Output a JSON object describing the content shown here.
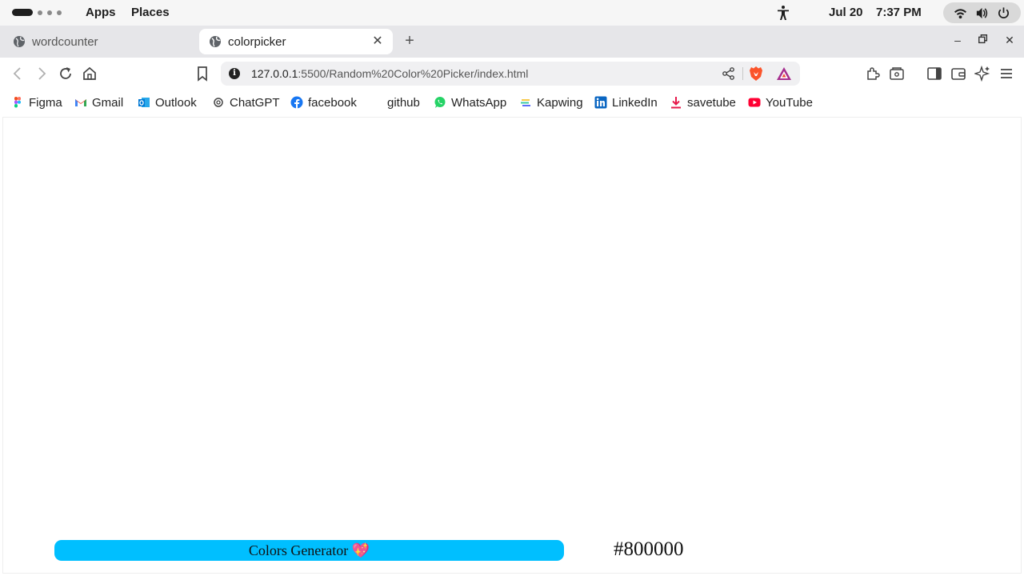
{
  "topbar": {
    "apps": "Apps",
    "places": "Places",
    "date": "Jul 20",
    "time": "7:37 PM"
  },
  "tabs": [
    {
      "title": "wordcounter",
      "active": false
    },
    {
      "title": "colorpicker",
      "active": true
    }
  ],
  "toolbar": {
    "url_host": "127.0.0.1",
    "url_path": ":5500/Random%20Color%20Picker/index.html"
  },
  "bookmarks": [
    {
      "label": "Figma",
      "icon": "figma-icon",
      "color": "#f24e1e"
    },
    {
      "label": "Gmail",
      "icon": "gmail-icon",
      "color": "#ea4335"
    },
    {
      "label": "Outlook",
      "icon": "outlook-icon",
      "color": "#0078d4"
    },
    {
      "label": "ChatGPT",
      "icon": "chatgpt-icon",
      "color": "#444444"
    },
    {
      "label": "facebook",
      "icon": "facebook-icon",
      "color": "#1877f2"
    },
    {
      "label": "github",
      "icon": "github-icon",
      "color": "#ffffff"
    },
    {
      "label": "WhatsApp",
      "icon": "whatsapp-icon",
      "color": "#25d366"
    },
    {
      "label": "Kapwing",
      "icon": "kapwing-icon",
      "color": "#3ac9a4"
    },
    {
      "label": "LinkedIn",
      "icon": "linkedin-icon",
      "color": "#0a66c2"
    },
    {
      "label": "savetube",
      "icon": "download-icon",
      "color": "#e6194b"
    },
    {
      "label": "YouTube",
      "icon": "youtube-icon",
      "color": "#ff0033"
    }
  ],
  "page": {
    "button_label": "Colors Generator 💖",
    "hex_value": "#800000",
    "button_color": "#00bfff"
  }
}
